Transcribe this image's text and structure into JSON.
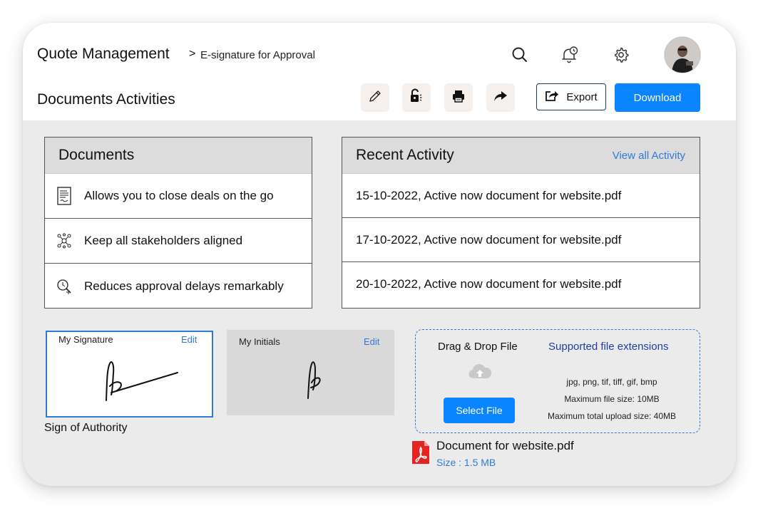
{
  "header": {
    "app_title": "Quote Management",
    "breadcrumb_sep": ">",
    "breadcrumb": "E-signature for Approval",
    "icons": [
      "search-icon",
      "bell-clock-icon",
      "gear-icon"
    ],
    "page_title": "Documents Activities"
  },
  "toolbar": {
    "tools": [
      "pencil-icon",
      "unlock-icon",
      "print-icon",
      "share-icon"
    ],
    "export_label": "Export",
    "download_label": "Download"
  },
  "documents": {
    "title": "Documents",
    "items": [
      {
        "icon": "document-icon",
        "label": "Allows you to close deals on the go"
      },
      {
        "icon": "stakeholders-icon",
        "label": "Keep all stakeholders aligned"
      },
      {
        "icon": "clock-search-icon",
        "label": "Reduces approval delays remarkably"
      }
    ]
  },
  "activity": {
    "title": "Recent Activity",
    "view_all": "View all Activity",
    "items": [
      "15-10-2022, Active now document for website.pdf",
      "17-10-2022, Active now document for website.pdf",
      "20-10-2022, Active now document for website.pdf"
    ]
  },
  "signature": {
    "label": "My Signature",
    "edit": "Edit",
    "caption": "Sign of Authority"
  },
  "initials": {
    "label": "My Initials",
    "edit": "Edit"
  },
  "upload": {
    "title": "Drag & Drop File",
    "supported_title": "Supported file extensions",
    "extensions": "jpg, png, tif, tiff, gif, bmp",
    "max_file": "Maximum file size: 10MB",
    "max_total": "Maximum total upload size: 40MB",
    "select_label": "Select File"
  },
  "file": {
    "name": "Document for website.pdf",
    "size": "Size : 1.5 MB"
  },
  "colors": {
    "accent": "#0a84ff",
    "link": "#2e7bd6",
    "pdf_red": "#e52421"
  }
}
